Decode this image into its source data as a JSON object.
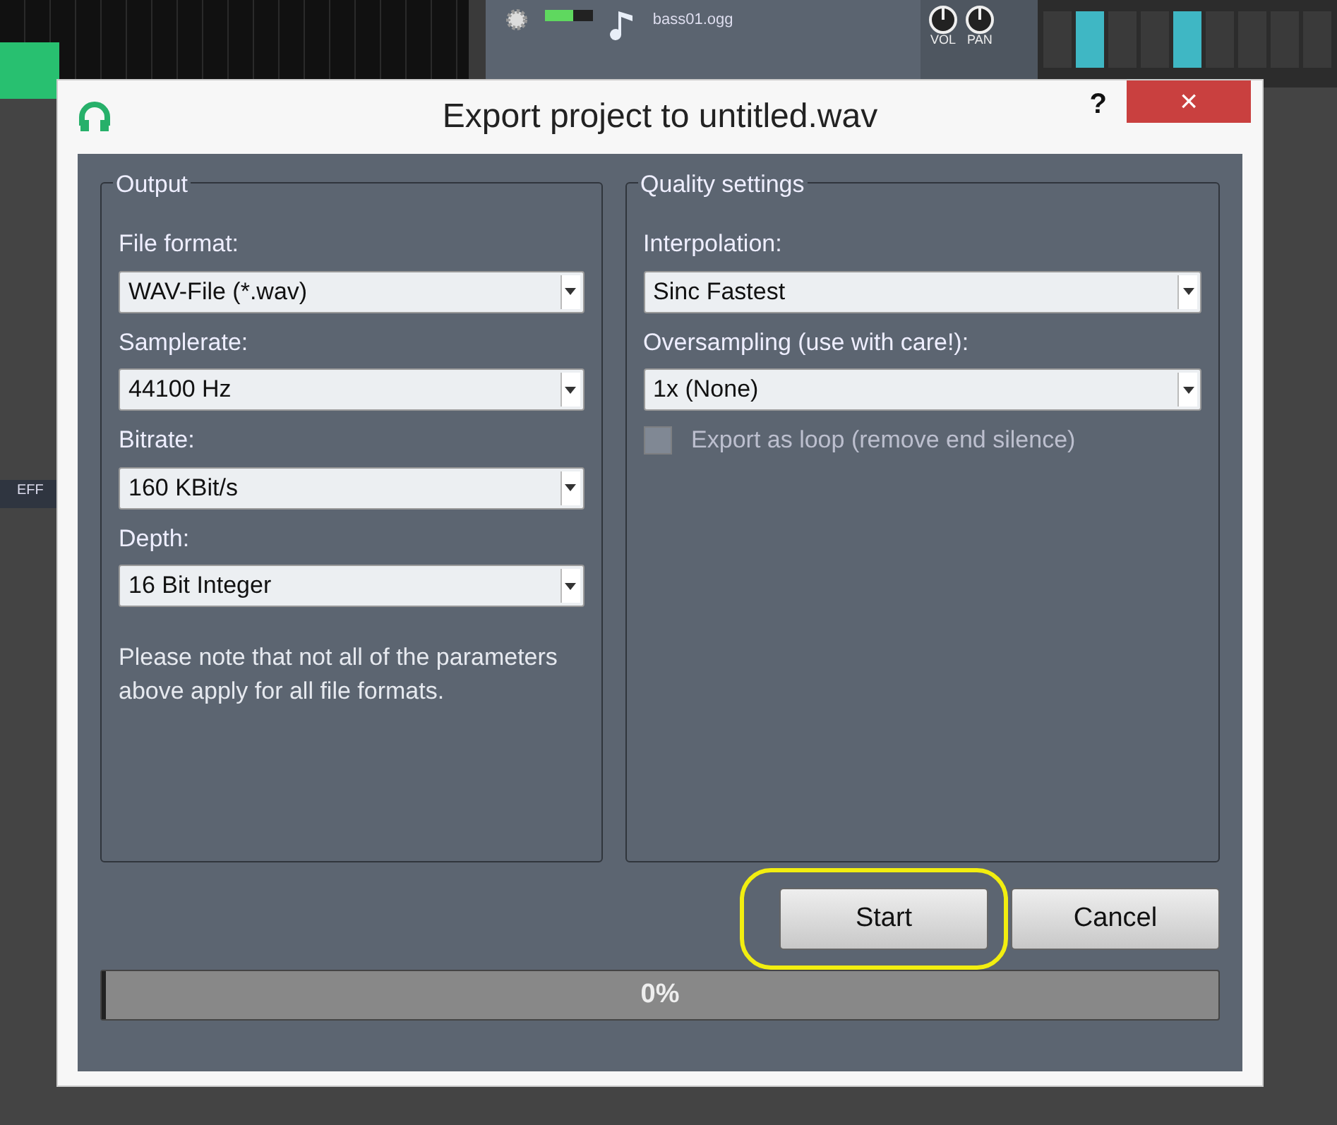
{
  "background": {
    "track_name": "bass01.ogg",
    "knob_labels": [
      "VOL",
      "PAN"
    ],
    "side_label": "EFF"
  },
  "dialog": {
    "title": "Export project to untitled.wav",
    "help": "?",
    "close": "×",
    "groups": [
      {
        "title": "Output",
        "fields": [
          {
            "label": "File format:",
            "value": "WAV-File (*.wav)"
          },
          {
            "label": "Samplerate:",
            "value": "44100 Hz"
          },
          {
            "label": "Bitrate:",
            "value": "160 KBit/s"
          },
          {
            "label": "Depth:",
            "value": "16 Bit Integer"
          }
        ],
        "note": "Please note that not all of the parameters above apply for all file formats."
      },
      {
        "title": "Quality settings",
        "fields": [
          {
            "label": "Interpolation:",
            "value": "Sinc Fastest"
          },
          {
            "label": "Oversampling (use with care!):",
            "value": "1x (None)"
          }
        ],
        "checkbox": {
          "label": "Export as loop (remove end silence)",
          "checked": false,
          "disabled": true
        }
      }
    ],
    "buttons": [
      {
        "label": "Start",
        "highlighted": true
      },
      {
        "label": "Cancel",
        "highlighted": false
      }
    ],
    "progress": {
      "level": 0,
      "text": "0%"
    }
  }
}
